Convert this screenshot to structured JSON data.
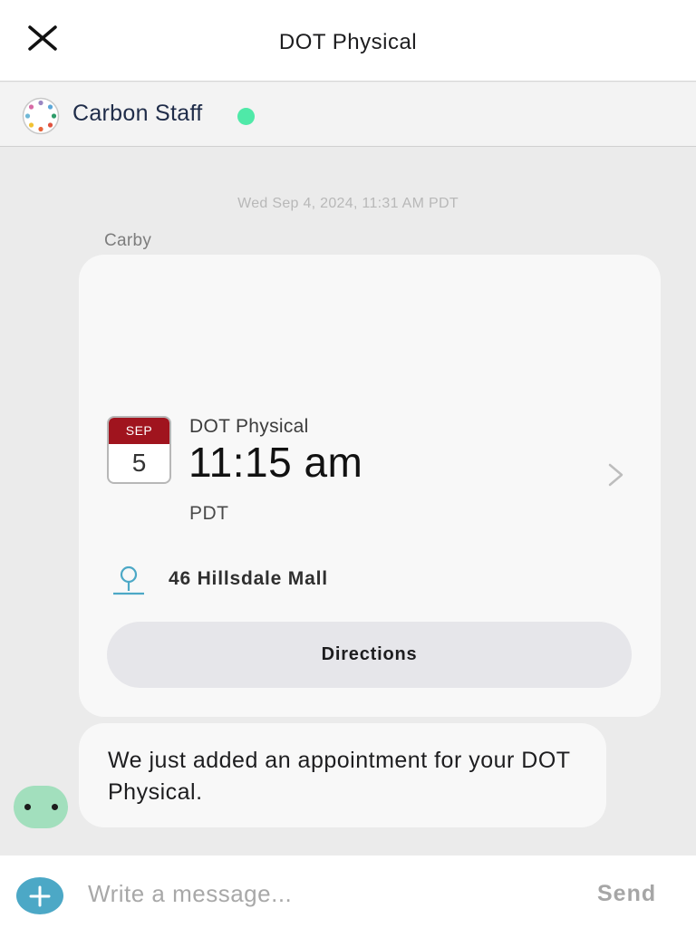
{
  "header": {
    "title": "DOT Physical",
    "close_icon": "close-icon"
  },
  "staff": {
    "name": "Carbon Staff",
    "avatar_icon": "carbon-logo-icon",
    "status_color": "#4fe9a8"
  },
  "conversation": {
    "timestamp": "Wed Sep 4, 2024, 11:31 AM PDT",
    "sender": "Carby",
    "appointment_card": {
      "calendar_month": "SEP",
      "calendar_day": "5",
      "title": "DOT Physical",
      "time": "11:15 am",
      "timezone": "PDT",
      "address": "46 Hillsdale Mall",
      "directions_label": "Directions",
      "calendar_accent": "#a0141e",
      "pin_color": "#4ca8c6"
    },
    "message": {
      "text": "We just added an appointment for your DOT Physical."
    }
  },
  "composer": {
    "placeholder": "Write a message...",
    "value": "",
    "send_label": "Send",
    "add_icon": "plus-icon",
    "add_color": "#4ca8c6"
  }
}
